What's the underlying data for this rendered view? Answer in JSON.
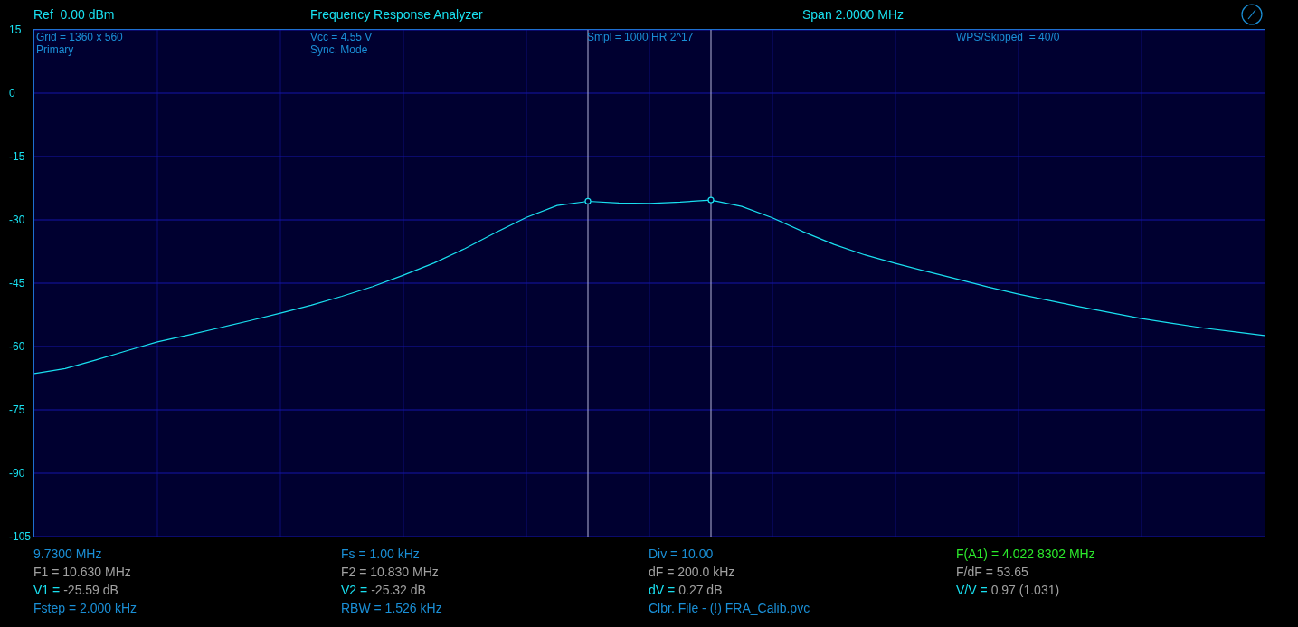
{
  "header": {
    "reference": "Ref  0.00 dBm",
    "title": "Frequency Response Analyzer",
    "span": "Span 2.0000 MHz"
  },
  "plot_info": [
    [
      "Grid = 1360 x 560",
      "Primary"
    ],
    [
      "Vcc = 4.55 V",
      "Sync. Mode"
    ],
    [
      "Smpl = 1000 HR 2^17"
    ],
    [
      "WPS/Skipped  = 40/0"
    ]
  ],
  "chart_data": {
    "type": "line",
    "grid": true,
    "ylim": [
      -105,
      15
    ],
    "yticks": [
      15,
      0,
      -15,
      -30,
      -45,
      -60,
      -75,
      -90,
      -105
    ],
    "categories": [
      null,
      null,
      null,
      null,
      null,
      null,
      null,
      null,
      null,
      null,
      null,
      null,
      null,
      null,
      null,
      null,
      null,
      null,
      null,
      null,
      null,
      null,
      null,
      null,
      null,
      null,
      null,
      null,
      null,
      null,
      null,
      null,
      null,
      null,
      null,
      null,
      null,
      null,
      null,
      null,
      null
    ],
    "series": [
      {
        "color": "#19e0f0",
        "values": [
          -66.4,
          -65.2,
          -63.2,
          -61.0,
          -58.9,
          -57.3,
          -55.6,
          -53.9,
          -52.1,
          -50.2,
          -48.1,
          -45.8,
          -43.1,
          -40.2,
          -36.8,
          -33.0,
          -29.4,
          -26.6,
          -25.6,
          -26.0,
          -26.1,
          -25.8,
          -25.3,
          -26.8,
          -29.5,
          -32.8,
          -35.8,
          -38.3,
          -40.3,
          -42.2,
          -44.0,
          -45.9,
          -47.6,
          -49.1,
          -50.6,
          -52.0,
          -53.4,
          -54.5,
          -55.6,
          -56.5,
          -57.4
        ]
      }
    ]
  },
  "cursors": [
    {
      "level": 0.45
    },
    {
      "level": 0.55
    }
  ],
  "readouts": [
    [
      {
        "kind": "info",
        "text": "9.7300 MHz"
      },
      {
        "kind": "measure",
        "text": "F1 = 10.630 MHz"
      },
      {
        "kind": "marker",
        "label": "V1 =",
        "value": "-25.59 dB"
      },
      {
        "kind": "info",
        "text": "Fstep = 2.000 kHz"
      }
    ],
    [
      {
        "kind": "info",
        "text": "Fs = 1.00 kHz"
      },
      {
        "kind": "measure",
        "text": "F2 = 10.830 MHz"
      },
      {
        "kind": "marker",
        "label": "V2 =",
        "value": "-25.32 dB"
      },
      {
        "kind": "info",
        "text": "RBW = 1.526 kHz"
      }
    ],
    [
      {
        "kind": "info",
        "text": "Div = 10.00"
      },
      {
        "kind": "measure",
        "text": "dF = 200.0 kHz"
      },
      {
        "kind": "marker",
        "label": "dV =",
        "value": "0.27 dB"
      },
      {
        "kind": "info",
        "text": "Clbr. File - (!) FRA_Calib.pvc"
      }
    ],
    [
      {
        "kind": "highlight",
        "text": "F(A1) = 4.022 8302 MHz"
      },
      {
        "kind": "measure",
        "text": "F/dF = 53.65"
      },
      {
        "kind": "marker",
        "label": "V/V =",
        "value": "0.97 (1.031)"
      }
    ]
  ]
}
